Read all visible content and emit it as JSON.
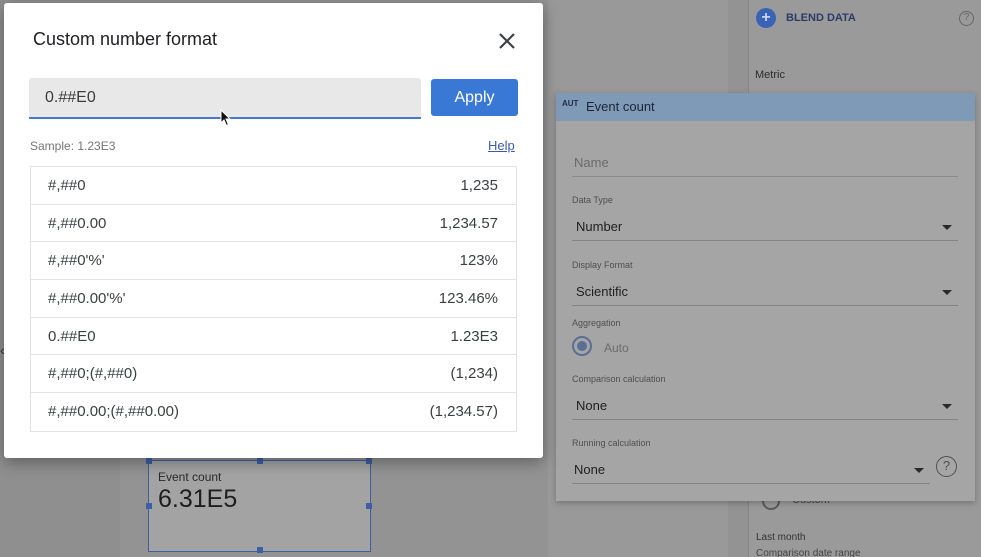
{
  "dialog": {
    "title": "Custom number format",
    "input_value": "0.##E0",
    "apply_label": "Apply",
    "sample_text": "Sample: 1.23E3",
    "help_label": "Help",
    "formats": [
      {
        "pattern": "#,##0",
        "sample": "1,235"
      },
      {
        "pattern": "#,##0.00",
        "sample": "1,234.57"
      },
      {
        "pattern": "#,##0'%'",
        "sample": "123%"
      },
      {
        "pattern": "#,##0.00'%'",
        "sample": "123.46%"
      },
      {
        "pattern": "0.##E0",
        "sample": "1.23E3"
      },
      {
        "pattern": "#,##0;(#,##0)",
        "sample": "(1,234)"
      },
      {
        "pattern": "#,##0.00;(#,##0.00)",
        "sample": "(1,234.57)"
      }
    ]
  },
  "field_panel": {
    "badge": "AUT",
    "title": "Event count",
    "name_placeholder": "Name",
    "data_type_label": "Data Type",
    "data_type_value": "Number",
    "display_format_label": "Display Format",
    "display_format_value": "Scientific",
    "aggregation_label": "Aggregation",
    "aggregation_value": "Auto",
    "comparison_label": "Comparison calculation",
    "comparison_value": "None",
    "running_label": "Running calculation",
    "running_value": "None",
    "help_glyph": "?"
  },
  "background": {
    "blend_label": "BLEND DATA",
    "blend_plus": "+",
    "blend_help": "?",
    "metric_label": "Metric",
    "custom_label": "Custom",
    "last_month": "Last month",
    "comparison_range": "Comparison date range"
  },
  "scorecard": {
    "label": "Event count",
    "value": "6.31E5"
  },
  "colors": {
    "accent": "#3a78d6",
    "link": "#3b5ba8",
    "field_header": "#7f9ab7"
  }
}
